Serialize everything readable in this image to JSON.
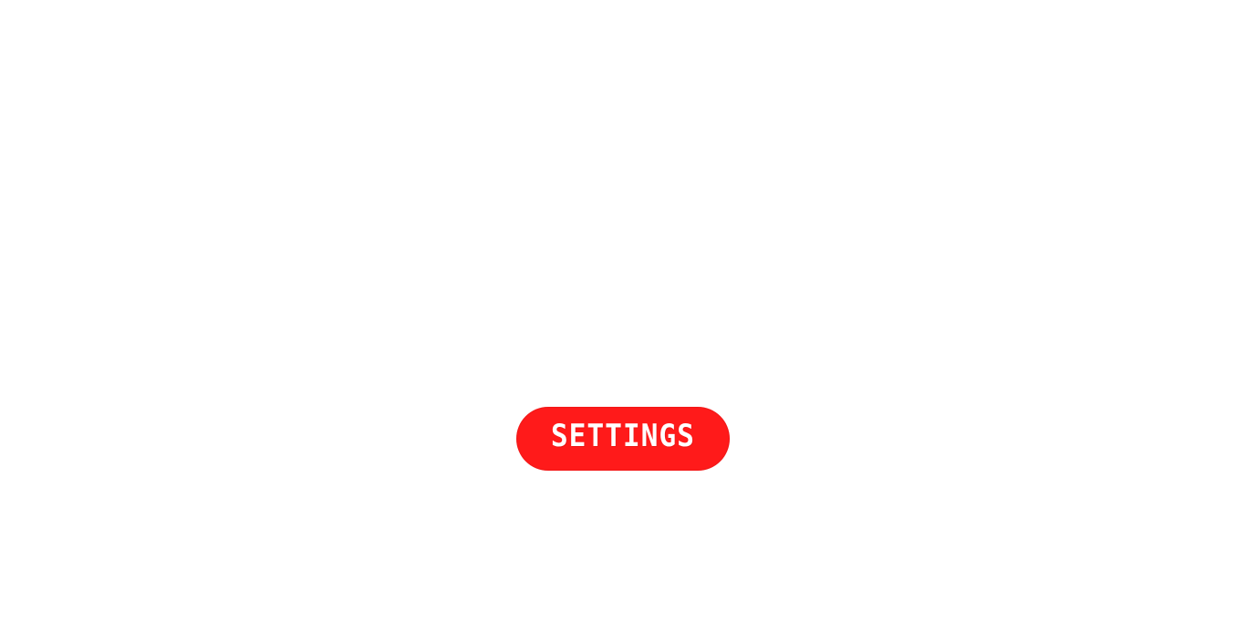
{
  "menu": {
    "settings_label": "SETTINGS"
  },
  "colors": {
    "background": "#ffffff",
    "button": "#ff1a1a",
    "button_text": "#ffffff"
  }
}
